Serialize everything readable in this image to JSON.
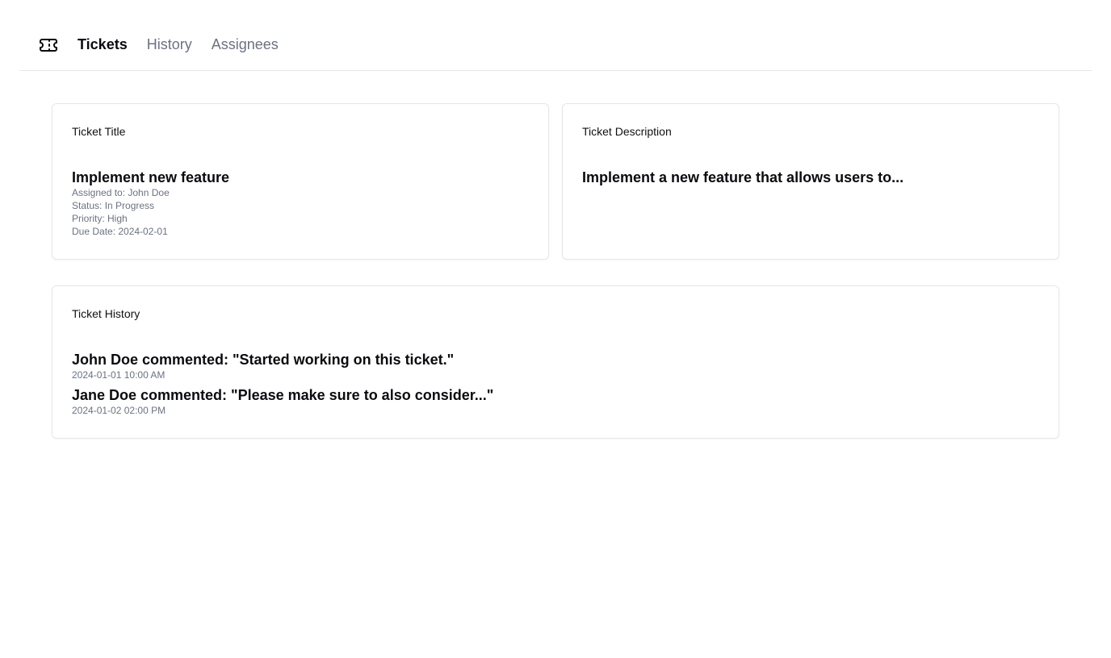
{
  "nav": {
    "logo_icon": "ticket-icon",
    "links": [
      {
        "label": "Tickets",
        "active": true
      },
      {
        "label": "History",
        "active": false
      },
      {
        "label": "Assignees",
        "active": false
      }
    ]
  },
  "ticket_title_card": {
    "header": "Ticket Title",
    "title": "Implement new feature",
    "assigned_to": "Assigned to: John Doe",
    "status": "Status: In Progress",
    "priority": "Priority: High",
    "due_date": "Due Date: 2024-02-01"
  },
  "ticket_description_card": {
    "header": "Ticket Description",
    "description": "Implement a new feature that allows users to..."
  },
  "ticket_history_card": {
    "header": "Ticket History",
    "entries": [
      {
        "text": "John Doe commented: \"Started working on this ticket.\"",
        "timestamp": "2024-01-01 10:00 AM"
      },
      {
        "text": "Jane Doe commented: \"Please make sure to also consider...\"",
        "timestamp": "2024-01-02 02:00 PM"
      }
    ]
  }
}
